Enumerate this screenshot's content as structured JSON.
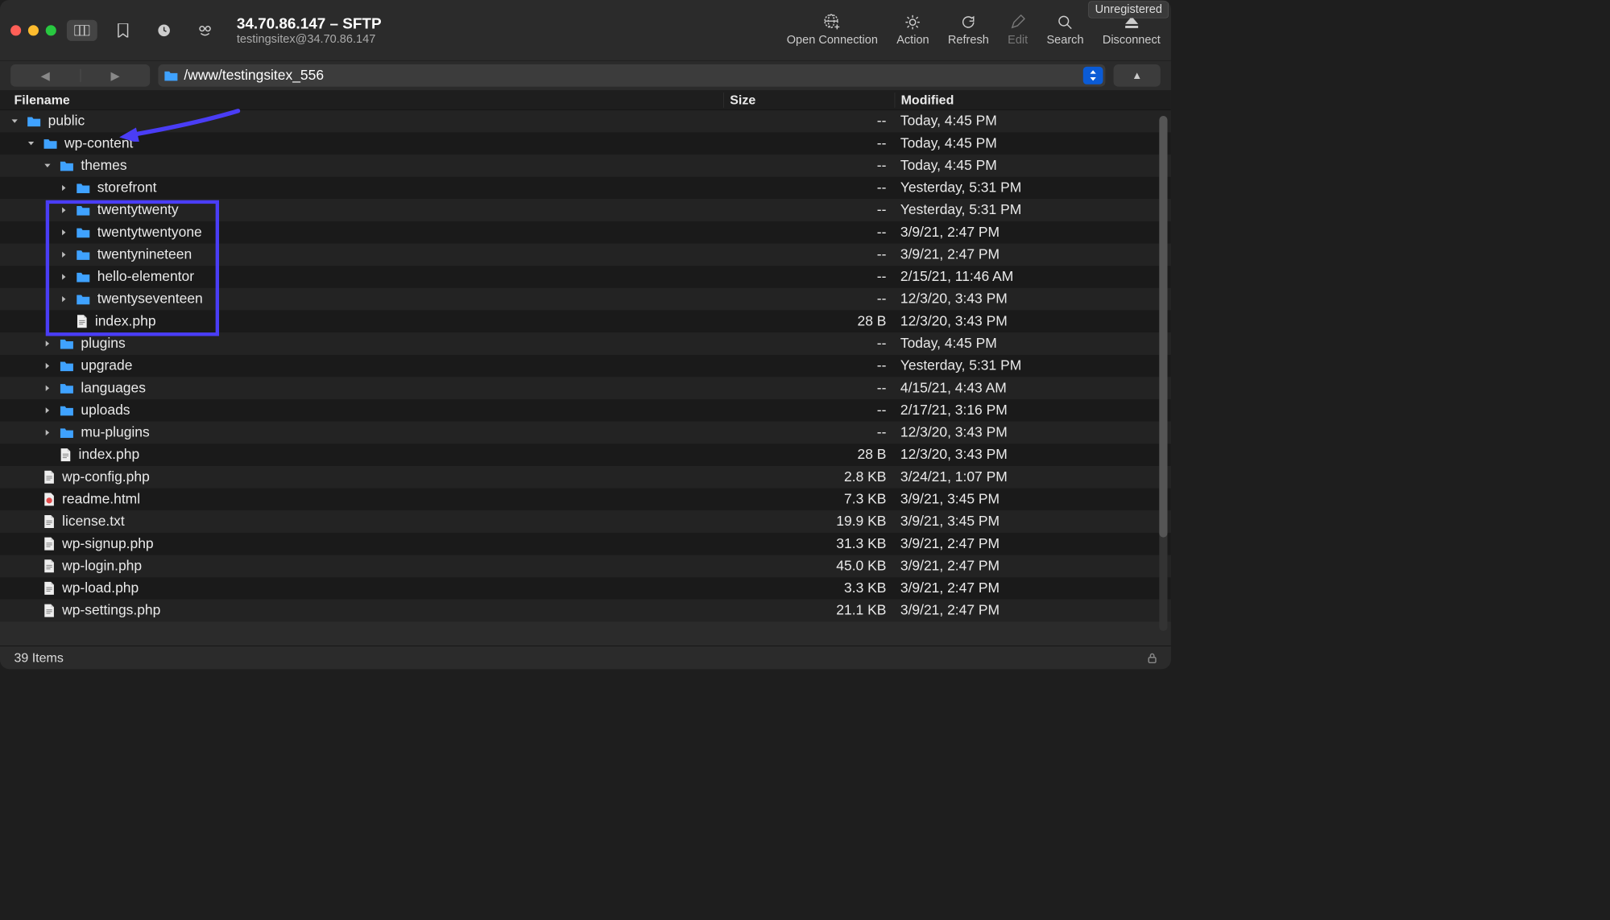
{
  "badge": {
    "unregistered": "Unregistered"
  },
  "title": "34.70.86.147 – SFTP",
  "subtitle": "testingsitex@34.70.86.147",
  "actions": {
    "open": "Open Connection",
    "action": "Action",
    "refresh": "Refresh",
    "edit": "Edit",
    "search": "Search",
    "disconnect": "Disconnect"
  },
  "path": "/www/testingsitex_556",
  "columns": {
    "name": "Filename",
    "size": "Size",
    "modified": "Modified"
  },
  "rows": [
    {
      "indent": 0,
      "twist": "down",
      "type": "folder",
      "name": "public",
      "size": "--",
      "mod": "Today, 4:45 PM"
    },
    {
      "indent": 1,
      "twist": "down",
      "type": "folder",
      "name": "wp-content",
      "size": "--",
      "mod": "Today, 4:45 PM"
    },
    {
      "indent": 2,
      "twist": "down",
      "type": "folder",
      "name": "themes",
      "size": "--",
      "mod": "Today, 4:45 PM"
    },
    {
      "indent": 3,
      "twist": "right",
      "type": "folder",
      "name": "storefront",
      "size": "--",
      "mod": "Yesterday, 5:31 PM"
    },
    {
      "indent": 3,
      "twist": "right",
      "type": "folder",
      "name": "twentytwenty",
      "size": "--",
      "mod": "Yesterday, 5:31 PM"
    },
    {
      "indent": 3,
      "twist": "right",
      "type": "folder",
      "name": "twentytwentyone",
      "size": "--",
      "mod": "3/9/21, 2:47 PM"
    },
    {
      "indent": 3,
      "twist": "right",
      "type": "folder",
      "name": "twentynineteen",
      "size": "--",
      "mod": "3/9/21, 2:47 PM"
    },
    {
      "indent": 3,
      "twist": "right",
      "type": "folder",
      "name": "hello-elementor",
      "size": "--",
      "mod": "2/15/21, 11:46 AM"
    },
    {
      "indent": 3,
      "twist": "right",
      "type": "folder",
      "name": "twentyseventeen",
      "size": "--",
      "mod": "12/3/20, 3:43 PM"
    },
    {
      "indent": 3,
      "twist": "none",
      "type": "file",
      "name": "index.php",
      "size": "28 B",
      "mod": "12/3/20, 3:43 PM"
    },
    {
      "indent": 2,
      "twist": "right",
      "type": "folder",
      "name": "plugins",
      "size": "--",
      "mod": "Today, 4:45 PM"
    },
    {
      "indent": 2,
      "twist": "right",
      "type": "folder",
      "name": "upgrade",
      "size": "--",
      "mod": "Yesterday, 5:31 PM"
    },
    {
      "indent": 2,
      "twist": "right",
      "type": "folder",
      "name": "languages",
      "size": "--",
      "mod": "4/15/21, 4:43 AM"
    },
    {
      "indent": 2,
      "twist": "right",
      "type": "folder",
      "name": "uploads",
      "size": "--",
      "mod": "2/17/21, 3:16 PM"
    },
    {
      "indent": 2,
      "twist": "right",
      "type": "folder",
      "name": "mu-plugins",
      "size": "--",
      "mod": "12/3/20, 3:43 PM"
    },
    {
      "indent": 2,
      "twist": "none",
      "type": "file",
      "name": "index.php",
      "size": "28 B",
      "mod": "12/3/20, 3:43 PM"
    },
    {
      "indent": 1,
      "twist": "none",
      "type": "file",
      "name": "wp-config.php",
      "size": "2.8 KB",
      "mod": "3/24/21, 1:07 PM"
    },
    {
      "indent": 1,
      "twist": "none",
      "type": "html",
      "name": "readme.html",
      "size": "7.3 KB",
      "mod": "3/9/21, 3:45 PM"
    },
    {
      "indent": 1,
      "twist": "none",
      "type": "file",
      "name": "license.txt",
      "size": "19.9 KB",
      "mod": "3/9/21, 3:45 PM"
    },
    {
      "indent": 1,
      "twist": "none",
      "type": "file",
      "name": "wp-signup.php",
      "size": "31.3 KB",
      "mod": "3/9/21, 2:47 PM"
    },
    {
      "indent": 1,
      "twist": "none",
      "type": "file",
      "name": "wp-login.php",
      "size": "45.0 KB",
      "mod": "3/9/21, 2:47 PM"
    },
    {
      "indent": 1,
      "twist": "none",
      "type": "file",
      "name": "wp-load.php",
      "size": "3.3 KB",
      "mod": "3/9/21, 2:47 PM"
    },
    {
      "indent": 1,
      "twist": "none",
      "type": "file",
      "name": "wp-settings.php",
      "size": "21.1 KB",
      "mod": "3/9/21, 2:47 PM"
    }
  ],
  "status": {
    "items": "39 Items"
  }
}
